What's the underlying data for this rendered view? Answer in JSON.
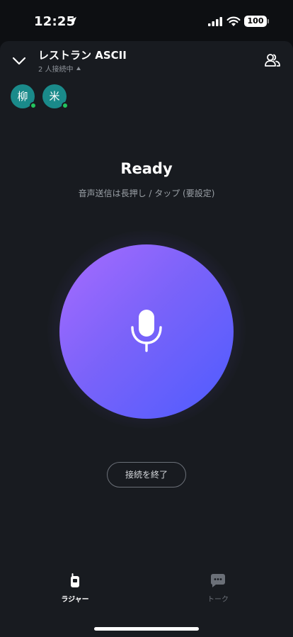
{
  "status_bar": {
    "time": "12:25",
    "battery": "100",
    "icons": [
      "location-arrow-icon",
      "signal-icon",
      "wifi-icon",
      "battery-icon"
    ]
  },
  "header": {
    "title": "レストラン ASCII",
    "subtitle": "2 人接続中",
    "icons": [
      "chevron-down-icon",
      "members-icon"
    ]
  },
  "participants": [
    {
      "initial": "柳",
      "online": true
    },
    {
      "initial": "米",
      "online": true
    }
  ],
  "main": {
    "status": "Ready",
    "hint": "音声送信は長押し / タップ (要設定)",
    "mic_icon": "microphone-icon",
    "end_button": "接続を終了"
  },
  "tabs": [
    {
      "label": "ラジャー",
      "icon": "walkie-talkie-icon",
      "active": true
    },
    {
      "label": "トーク",
      "icon": "chat-bubble-icon",
      "active": false
    }
  ],
  "colors": {
    "background": "#0d0f12",
    "sheet": "#181b20",
    "avatar": "#1a8a8a",
    "online": "#22c55e",
    "gradient_start": "#a86bff",
    "gradient_end": "#4d5cff"
  }
}
